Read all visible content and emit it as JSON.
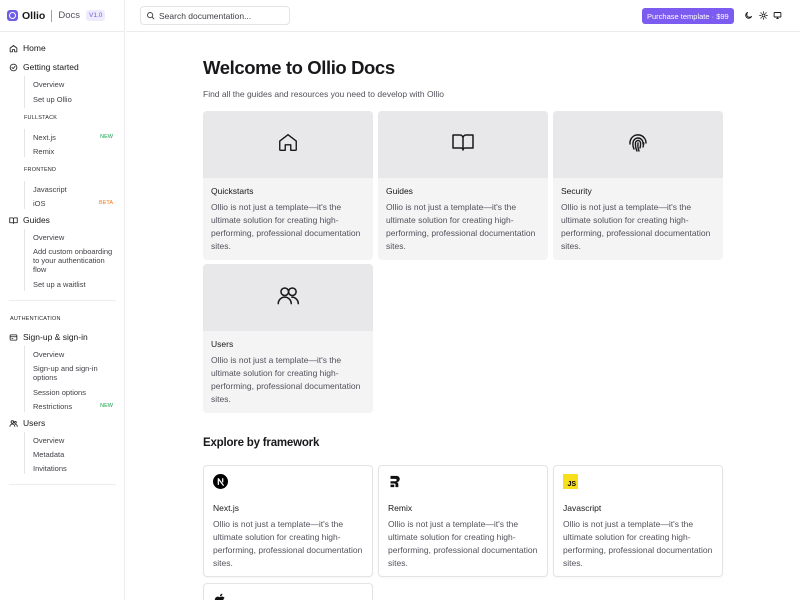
{
  "header": {
    "logo_text": "Ollio",
    "docs_label": "Docs",
    "version": "V1.0",
    "search_placeholder": "Search documentation...",
    "purchase_label": "Purchase template · $99"
  },
  "sidebar": {
    "home": "Home",
    "getting_started": "Getting started",
    "gs_overview": "Overview",
    "gs_setup": "Set up Ollio",
    "fullstack_label": "FULLSTACK",
    "nextjs": "Next.js",
    "new_badge": "NEW",
    "remix": "Remix",
    "frontend_label": "FRONTEND",
    "javascript": "Javascript",
    "ios": "iOS",
    "beta_badge": "BETA",
    "guides": "Guides",
    "guides_overview": "Overview",
    "guides_onboarding": "Add custom onboarding to your authentication flow",
    "guides_waitlist": "Set up a waitlist",
    "authentication_label": "AUTHENTICATION",
    "signup": "Sign-up & sign-in",
    "signup_overview": "Overview",
    "signup_options": "Sign-up and sign-in options",
    "session_options": "Session options",
    "restrictions": "Restrictions",
    "users": "Users",
    "users_overview": "Overview",
    "metadata": "Metadata",
    "invitations": "Invitations"
  },
  "main": {
    "title": "Welcome to Ollio Docs",
    "lead": "Find all the guides and resources you need to develop with Ollio",
    "cards": [
      {
        "title": "Quickstarts",
        "desc": "Ollio is not just a template—it's the ultimate solution for creating high-performing, professional documentation sites.",
        "icon": "home-icon"
      },
      {
        "title": "Guides",
        "desc": "Ollio is not just a template—it's the ultimate solution for creating high-performing, professional documentation sites.",
        "icon": "book-icon"
      },
      {
        "title": "Security",
        "desc": "Ollio is not just a template—it's the ultimate solution for creating high-performing, professional documentation sites.",
        "icon": "fingerprint-icon"
      },
      {
        "title": "Users",
        "desc": "Ollio is not just a template—it's the ultimate solution for creating high-performing, professional documentation sites.",
        "icon": "users-icon"
      }
    ],
    "explore_title": "Explore by framework",
    "frameworks": [
      {
        "title": "Next.js",
        "desc": "Ollio is not just a template—it's the ultimate solution for creating high-performing, professional documentation sites.",
        "icon": "nextjs-icon"
      },
      {
        "title": "Remix",
        "desc": "Ollio is not just a template—it's the ultimate solution for creating high-performing, professional documentation sites.",
        "icon": "remix-icon"
      },
      {
        "title": "Javascript",
        "desc": "Ollio is not just a template—it's the ultimate solution for creating high-performing, professional documentation sites.",
        "icon": "javascript-icon",
        "icon_text": "JS"
      }
    ]
  },
  "colors": {
    "accent": "#7c5cf0",
    "new_badge": "#16a34a",
    "beta_badge": "#f97316"
  }
}
